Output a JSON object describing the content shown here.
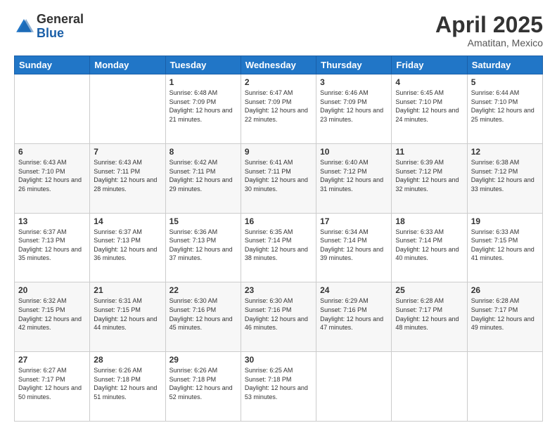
{
  "logo": {
    "general": "General",
    "blue": "Blue"
  },
  "header": {
    "month": "April 2025",
    "location": "Amatitan, Mexico"
  },
  "days_of_week": [
    "Sunday",
    "Monday",
    "Tuesday",
    "Wednesday",
    "Thursday",
    "Friday",
    "Saturday"
  ],
  "weeks": [
    [
      {
        "day": "",
        "info": ""
      },
      {
        "day": "",
        "info": ""
      },
      {
        "day": "1",
        "info": "Sunrise: 6:48 AM\nSunset: 7:09 PM\nDaylight: 12 hours and 21 minutes."
      },
      {
        "day": "2",
        "info": "Sunrise: 6:47 AM\nSunset: 7:09 PM\nDaylight: 12 hours and 22 minutes."
      },
      {
        "day": "3",
        "info": "Sunrise: 6:46 AM\nSunset: 7:09 PM\nDaylight: 12 hours and 23 minutes."
      },
      {
        "day": "4",
        "info": "Sunrise: 6:45 AM\nSunset: 7:10 PM\nDaylight: 12 hours and 24 minutes."
      },
      {
        "day": "5",
        "info": "Sunrise: 6:44 AM\nSunset: 7:10 PM\nDaylight: 12 hours and 25 minutes."
      }
    ],
    [
      {
        "day": "6",
        "info": "Sunrise: 6:43 AM\nSunset: 7:10 PM\nDaylight: 12 hours and 26 minutes."
      },
      {
        "day": "7",
        "info": "Sunrise: 6:43 AM\nSunset: 7:11 PM\nDaylight: 12 hours and 28 minutes."
      },
      {
        "day": "8",
        "info": "Sunrise: 6:42 AM\nSunset: 7:11 PM\nDaylight: 12 hours and 29 minutes."
      },
      {
        "day": "9",
        "info": "Sunrise: 6:41 AM\nSunset: 7:11 PM\nDaylight: 12 hours and 30 minutes."
      },
      {
        "day": "10",
        "info": "Sunrise: 6:40 AM\nSunset: 7:12 PM\nDaylight: 12 hours and 31 minutes."
      },
      {
        "day": "11",
        "info": "Sunrise: 6:39 AM\nSunset: 7:12 PM\nDaylight: 12 hours and 32 minutes."
      },
      {
        "day": "12",
        "info": "Sunrise: 6:38 AM\nSunset: 7:12 PM\nDaylight: 12 hours and 33 minutes."
      }
    ],
    [
      {
        "day": "13",
        "info": "Sunrise: 6:37 AM\nSunset: 7:13 PM\nDaylight: 12 hours and 35 minutes."
      },
      {
        "day": "14",
        "info": "Sunrise: 6:37 AM\nSunset: 7:13 PM\nDaylight: 12 hours and 36 minutes."
      },
      {
        "day": "15",
        "info": "Sunrise: 6:36 AM\nSunset: 7:13 PM\nDaylight: 12 hours and 37 minutes."
      },
      {
        "day": "16",
        "info": "Sunrise: 6:35 AM\nSunset: 7:14 PM\nDaylight: 12 hours and 38 minutes."
      },
      {
        "day": "17",
        "info": "Sunrise: 6:34 AM\nSunset: 7:14 PM\nDaylight: 12 hours and 39 minutes."
      },
      {
        "day": "18",
        "info": "Sunrise: 6:33 AM\nSunset: 7:14 PM\nDaylight: 12 hours and 40 minutes."
      },
      {
        "day": "19",
        "info": "Sunrise: 6:33 AM\nSunset: 7:15 PM\nDaylight: 12 hours and 41 minutes."
      }
    ],
    [
      {
        "day": "20",
        "info": "Sunrise: 6:32 AM\nSunset: 7:15 PM\nDaylight: 12 hours and 42 minutes."
      },
      {
        "day": "21",
        "info": "Sunrise: 6:31 AM\nSunset: 7:15 PM\nDaylight: 12 hours and 44 minutes."
      },
      {
        "day": "22",
        "info": "Sunrise: 6:30 AM\nSunset: 7:16 PM\nDaylight: 12 hours and 45 minutes."
      },
      {
        "day": "23",
        "info": "Sunrise: 6:30 AM\nSunset: 7:16 PM\nDaylight: 12 hours and 46 minutes."
      },
      {
        "day": "24",
        "info": "Sunrise: 6:29 AM\nSunset: 7:16 PM\nDaylight: 12 hours and 47 minutes."
      },
      {
        "day": "25",
        "info": "Sunrise: 6:28 AM\nSunset: 7:17 PM\nDaylight: 12 hours and 48 minutes."
      },
      {
        "day": "26",
        "info": "Sunrise: 6:28 AM\nSunset: 7:17 PM\nDaylight: 12 hours and 49 minutes."
      }
    ],
    [
      {
        "day": "27",
        "info": "Sunrise: 6:27 AM\nSunset: 7:17 PM\nDaylight: 12 hours and 50 minutes."
      },
      {
        "day": "28",
        "info": "Sunrise: 6:26 AM\nSunset: 7:18 PM\nDaylight: 12 hours and 51 minutes."
      },
      {
        "day": "29",
        "info": "Sunrise: 6:26 AM\nSunset: 7:18 PM\nDaylight: 12 hours and 52 minutes."
      },
      {
        "day": "30",
        "info": "Sunrise: 6:25 AM\nSunset: 7:18 PM\nDaylight: 12 hours and 53 minutes."
      },
      {
        "day": "",
        "info": ""
      },
      {
        "day": "",
        "info": ""
      },
      {
        "day": "",
        "info": ""
      }
    ]
  ]
}
